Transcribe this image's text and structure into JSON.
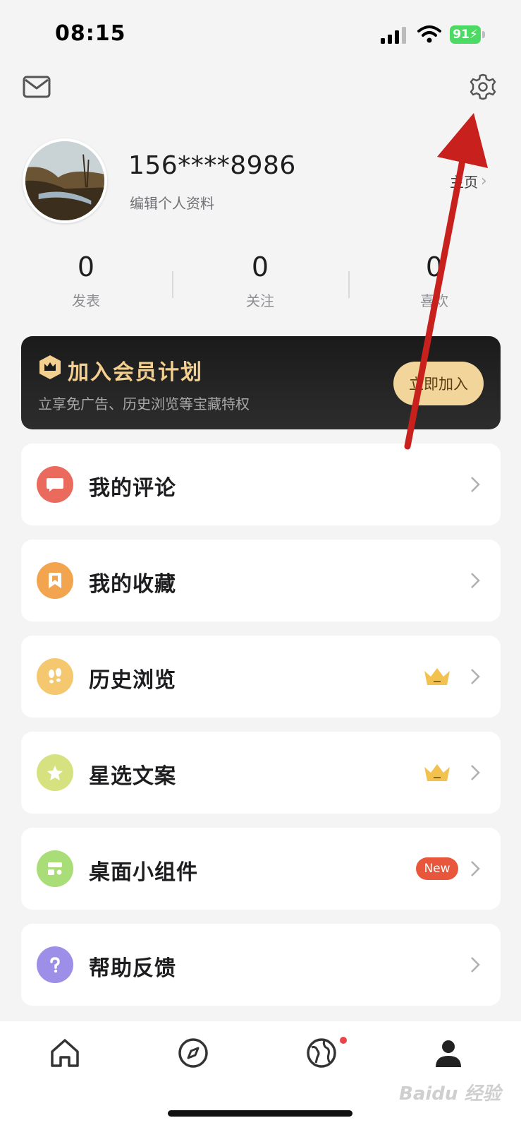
{
  "status_bar": {
    "time": "08:15",
    "battery": "91"
  },
  "profile": {
    "phone": "156****8986",
    "edit_label": "编辑个人资料",
    "homepage_label": "主页"
  },
  "stats": [
    {
      "value": "0",
      "label": "发表"
    },
    {
      "value": "0",
      "label": "关注"
    },
    {
      "value": "0",
      "label": "喜欢"
    }
  ],
  "vip": {
    "title": "加入会员计划",
    "subtitle": "立享免广告、历史浏览等宝藏特权",
    "button": "立即加入"
  },
  "menu": [
    {
      "label": "我的评论",
      "icon": "comment-icon",
      "color": "#ea6b5e"
    },
    {
      "label": "我的收藏",
      "icon": "bookmark-icon",
      "color": "#f2a44f"
    },
    {
      "label": "历史浏览",
      "icon": "footprints-icon",
      "color": "#f5c76f"
    },
    {
      "label": "星选文案",
      "icon": "star-icon",
      "color": "#d6e27f"
    },
    {
      "label": "桌面小组件",
      "icon": "widget-icon",
      "color": "#a9dd77",
      "badge": "New"
    },
    {
      "label": "帮助反馈",
      "icon": "help-icon",
      "color": "#9d8ee8"
    }
  ],
  "tabbar": [
    {
      "name": "home-icon"
    },
    {
      "name": "compass-icon"
    },
    {
      "name": "globe-icon"
    },
    {
      "name": "person-icon"
    }
  ],
  "colors": {
    "accent_gold": "#f3d08f",
    "badge_red": "#e8563b",
    "background": "#f4f4f4"
  },
  "watermark": "Baidu 经验"
}
